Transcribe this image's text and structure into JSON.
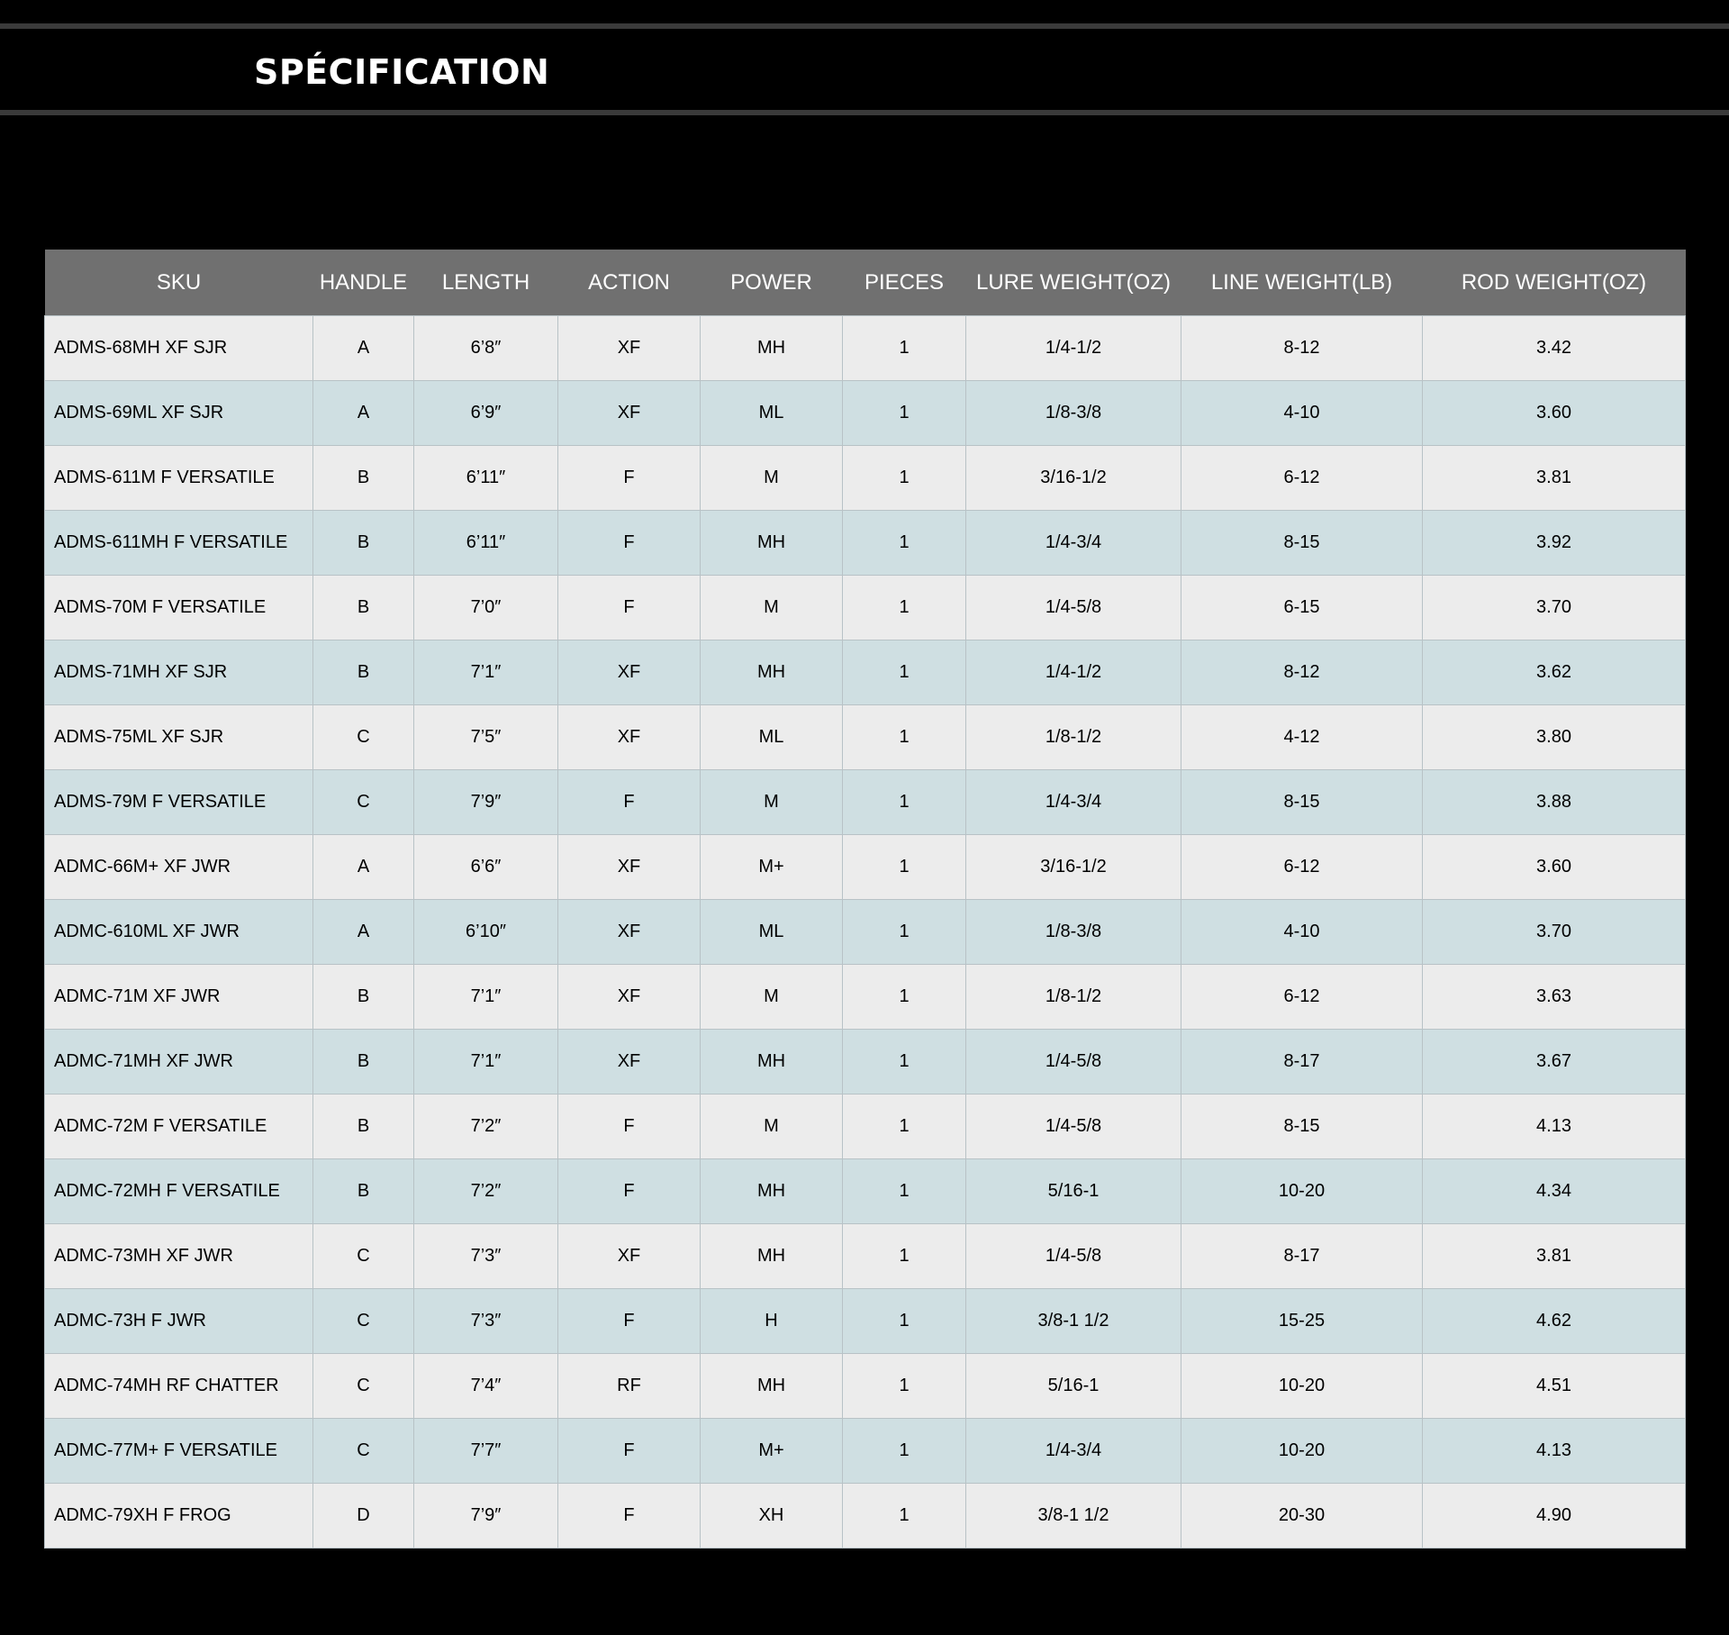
{
  "header": {
    "title": "SPÉCIFICATION"
  },
  "table": {
    "columns": [
      "SKU",
      "HANDLE",
      "LENGTH",
      "ACTION",
      "POWER",
      "PIECES",
      "LURE WEIGHT(OZ)",
      "LINE  WEIGHT(LB)",
      "ROD  WEIGHT(OZ)"
    ],
    "rows": [
      [
        "ADMS-68MH XF SJR",
        "A",
        "6’8″",
        "XF",
        "MH",
        "1",
        "1/4-1/2",
        "8-12",
        "3.42"
      ],
      [
        "ADMS-69ML XF SJR",
        "A",
        "6’9″",
        "XF",
        "ML",
        "1",
        "1/8-3/8",
        "4-10",
        "3.60"
      ],
      [
        "ADMS-611M F VERSATILE",
        "B",
        "6’11″",
        "F",
        "M",
        "1",
        "3/16-1/2",
        "6-12",
        "3.81"
      ],
      [
        "ADMS-611MH F VERSATILE",
        "B",
        "6’11″",
        "F",
        "MH",
        "1",
        "1/4-3/4",
        "8-15",
        "3.92"
      ],
      [
        "ADMS-70M F VERSATILE",
        "B",
        "7’0″",
        "F",
        "M",
        "1",
        "1/4-5/8",
        "6-15",
        "3.70"
      ],
      [
        "ADMS-71MH XF SJR",
        "B",
        "7’1″",
        "XF",
        "MH",
        "1",
        "1/4-1/2",
        "8-12",
        "3.62"
      ],
      [
        "ADMS-75ML XF SJR",
        "C",
        "7’5″",
        "XF",
        "ML",
        "1",
        "1/8-1/2",
        "4-12",
        "3.80"
      ],
      [
        "ADMS-79M F VERSATILE",
        "C",
        "7’9″",
        "F",
        "M",
        "1",
        "1/4-3/4",
        "8-15",
        "3.88"
      ],
      [
        "ADMC-66M+ XF JWR",
        "A",
        "6’6″",
        "XF",
        "M+",
        "1",
        "3/16-1/2",
        "6-12",
        "3.60"
      ],
      [
        "ADMC-610ML XF JWR",
        "A",
        "6’10″",
        "XF",
        "ML",
        "1",
        "1/8-3/8",
        "4-10",
        "3.70"
      ],
      [
        "ADMC-71M XF JWR",
        "B",
        "7’1″",
        "XF",
        "M",
        "1",
        "1/8-1/2",
        "6-12",
        "3.63"
      ],
      [
        "ADMC-71MH XF JWR",
        "B",
        "7’1″",
        "XF",
        "MH",
        "1",
        "1/4-5/8",
        "8-17",
        "3.67"
      ],
      [
        "ADMC-72M F VERSATILE",
        "B",
        "7’2″",
        "F",
        "M",
        "1",
        "1/4-5/8",
        "8-15",
        "4.13"
      ],
      [
        "ADMC-72MH F VERSATILE",
        "B",
        "7’2″",
        "F",
        "MH",
        "1",
        "5/16-1",
        "10-20",
        "4.34"
      ],
      [
        "ADMC-73MH XF JWR",
        "C",
        "7’3″",
        "XF",
        "MH",
        "1",
        "1/4-5/8",
        "8-17",
        "3.81"
      ],
      [
        "ADMC-73H  F JWR",
        "C",
        "7’3″",
        "F",
        "H",
        "1",
        "3/8-1 1/2",
        "15-25",
        "4.62"
      ],
      [
        "ADMC-74MH RF CHATTER",
        "C",
        "7’4″",
        "RF",
        "MH",
        "1",
        "5/16-1",
        "10-20",
        "4.51"
      ],
      [
        "ADMC-77M+ F VERSATILE",
        "C",
        "7’7″",
        "F",
        "M+",
        "1",
        "1/4-3/4",
        "10-20",
        "4.13"
      ],
      [
        "ADMC-79XH F FROG",
        "D",
        "7’9″",
        "F",
        "XH",
        "1",
        "3/8-1 1/2",
        "20-30",
        "4.90"
      ]
    ]
  }
}
